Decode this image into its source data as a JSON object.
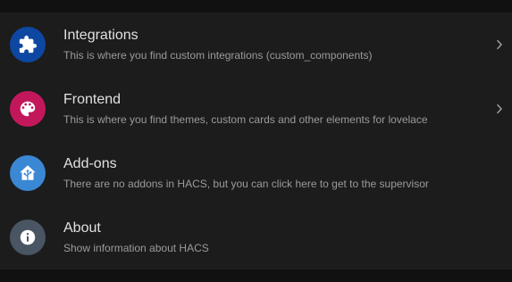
{
  "colors": {
    "page_background": "#111111",
    "card_background": "#1c1c1c",
    "title_text": "#e1e1e1",
    "subtitle_text": "#9b9b9b",
    "chevron": "#9e9e9e"
  },
  "items": [
    {
      "title": "Integrations",
      "subtitle": "This is where you find custom integrations (custom_components)",
      "icon": "puzzle-icon",
      "icon_color": "#0d47a1",
      "has_chevron": true
    },
    {
      "title": "Frontend",
      "subtitle": "This is where you find themes, custom cards and other elements for lovelace",
      "icon": "palette-icon",
      "icon_color": "#c2185b",
      "has_chevron": true
    },
    {
      "title": "Add-ons",
      "subtitle": "There are no addons in HACS, but you can click here to get to the supervisor",
      "icon": "home-assistant-icon",
      "icon_color": "#3a87d4",
      "has_chevron": false
    },
    {
      "title": "About",
      "subtitle": "Show information about HACS",
      "icon": "information-icon",
      "icon_color": "#4a5563",
      "has_chevron": false
    }
  ]
}
